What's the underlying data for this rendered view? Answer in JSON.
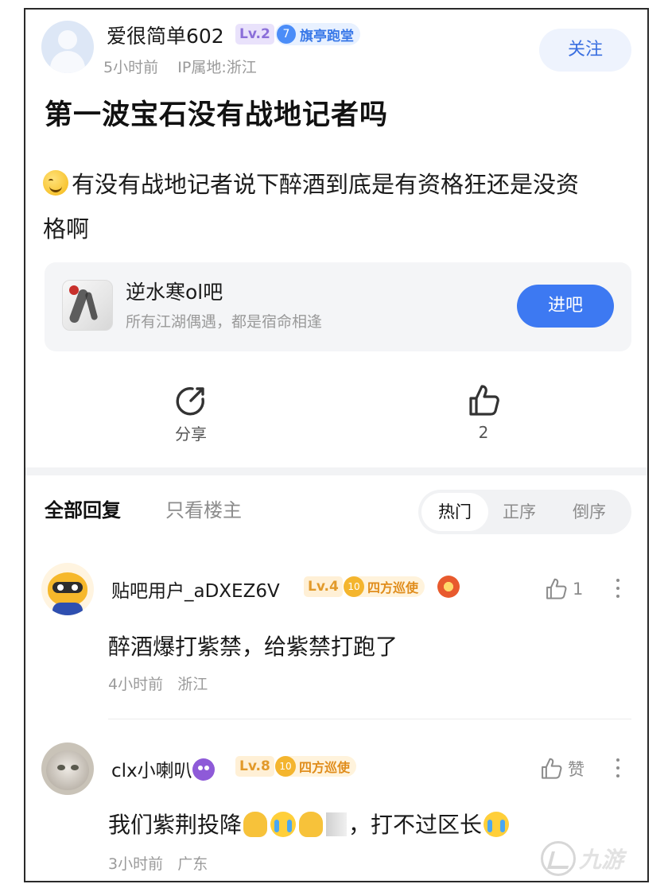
{
  "post": {
    "author": "爱很简单602",
    "level": "Lv.2",
    "title_badge_num": "7",
    "title_badge": "旗亭跑堂",
    "time": "5小时前",
    "ip": "IP属地:浙江",
    "follow_label": "关注",
    "title": "第一波宝石没有战地记者吗",
    "body_line1": "有没有战地记者说下醉酒到底是有资格狂还是没资",
    "body_line2": "格啊"
  },
  "forum": {
    "name": "逆水寒ol吧",
    "desc": "所有江湖偶遇，都是宿命相逢",
    "enter_label": "进吧"
  },
  "actions": {
    "share_label": "分享",
    "like_count": "2"
  },
  "filters": {
    "all_label": "全部回复",
    "op_only_label": "只看楼主",
    "sort_hot": "热门",
    "sort_asc": "正序",
    "sort_desc": "倒序"
  },
  "replies": [
    {
      "name": "贴吧用户_aDXEZ6V",
      "level": "Lv.4",
      "title_num": "10",
      "title": "四方巡使",
      "like_label": "1",
      "text": "醉酒爆打紫禁，给紫禁打跑了",
      "time": "4小时前",
      "location": "浙江"
    },
    {
      "name": "clx小喇叭",
      "level": "Lv.8",
      "title_num": "10",
      "title": "四方巡使",
      "like_label": "赞",
      "text_a": "我们紫荆投降",
      "text_b": "，打不过区长",
      "time": "3小时前",
      "location": "广东"
    }
  ],
  "watermark": {
    "text": "九游"
  },
  "colors": {
    "accent": "#3d79f2",
    "follow_bg": "#eef3fd",
    "level_purple": "#8b6fd9",
    "level_orange": "#e29a2b"
  }
}
